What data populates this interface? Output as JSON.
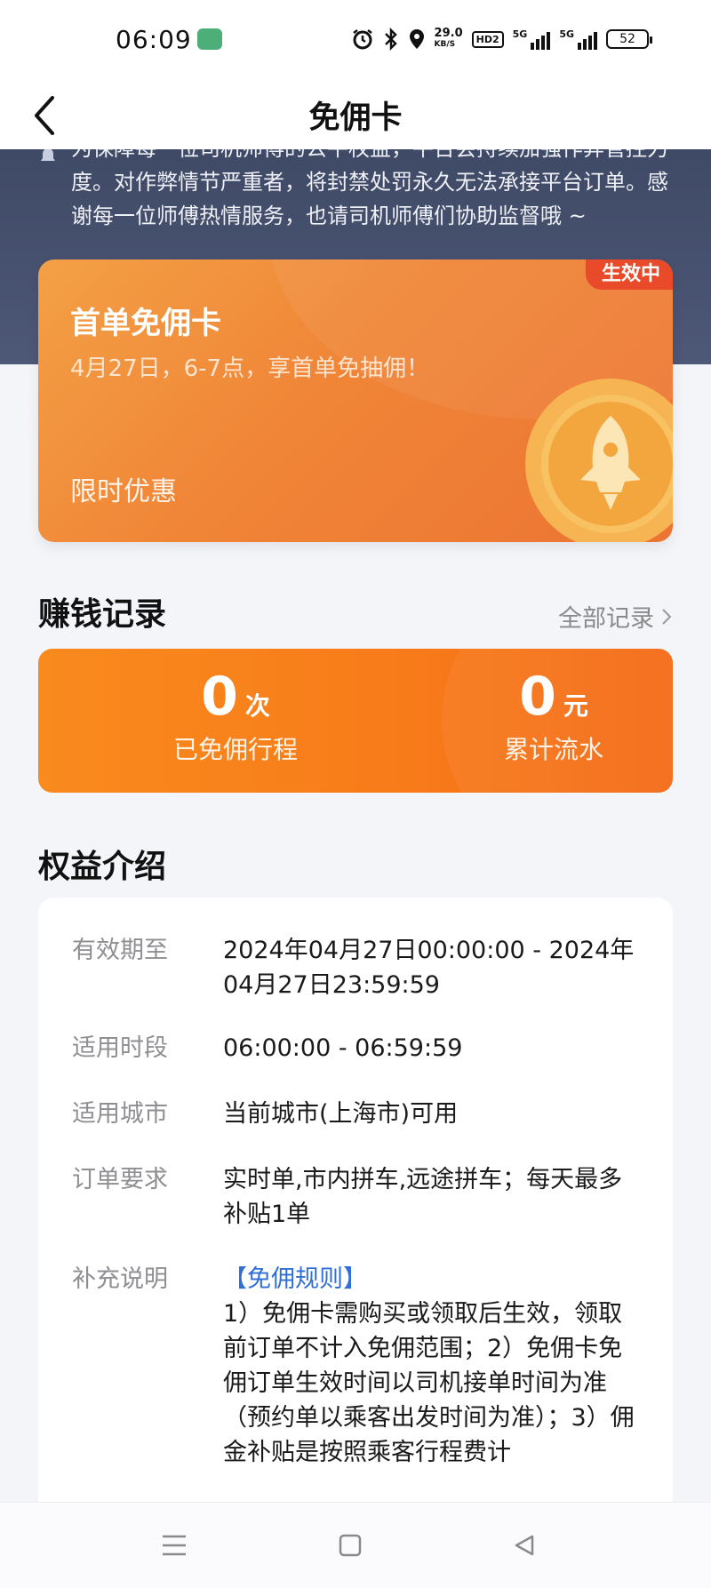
{
  "status_bar": {
    "time": "06:09",
    "network_speed_value": "29.0",
    "network_speed_unit": "KB/S",
    "hd_label": "HD2",
    "signal1_label": "5G",
    "signal2_label": "5G",
    "battery": "52"
  },
  "nav": {
    "title": "免佣卡"
  },
  "notice": {
    "text": "为保障每一位司机师傅的公平权益，平台会持续加强作弊管控力度。对作弊情节严重者，将封禁处罚永久无法承接平台订单。感谢每一位师傅热情服务，也请司机师傅们协助监督哦 ~"
  },
  "promo_card": {
    "badge": "生效中",
    "title": "首单免佣卡",
    "subtitle": "4月27日，6-7点，享首单免抽佣！",
    "tag": "限时优惠"
  },
  "earnings": {
    "section_title": "赚钱记录",
    "all_records_label": "全部记录",
    "trips_value": "0",
    "trips_unit": "次",
    "trips_label": "已免佣行程",
    "revenue_value": "0",
    "revenue_unit": "元",
    "revenue_label": "累计流水"
  },
  "benefits": {
    "section_title": "权益介绍",
    "rows": [
      {
        "label": "有效期至",
        "value": "2024年04月27日00:00:00 - 2024年04月27日23:59:59"
      },
      {
        "label": "适用时段",
        "value": "06:00:00 - 06:59:59"
      },
      {
        "label": "适用城市",
        "value": "当前城市(上海市)可用"
      },
      {
        "label": "订单要求",
        "value": "实时单,市内拼车,远途拼车；每天最多补贴1单"
      },
      {
        "label": "补充说明",
        "rule_title": "【免佣规则】",
        "value": "1）免佣卡需购买或领取后生效，领取前订单不计入免佣范围；2）免佣卡免佣订单生效时间以司机接单时间为准（预约单以乘客出发时间为准）；3）佣金补贴是按照乘客行程费计"
      }
    ]
  },
  "colors": {
    "hero_bg": "#4a5472",
    "promo_orange": "#f08537",
    "badge_red": "#e94b2a",
    "earn_orange": "#f87c1a",
    "rule_blue": "#2f6fd6"
  }
}
